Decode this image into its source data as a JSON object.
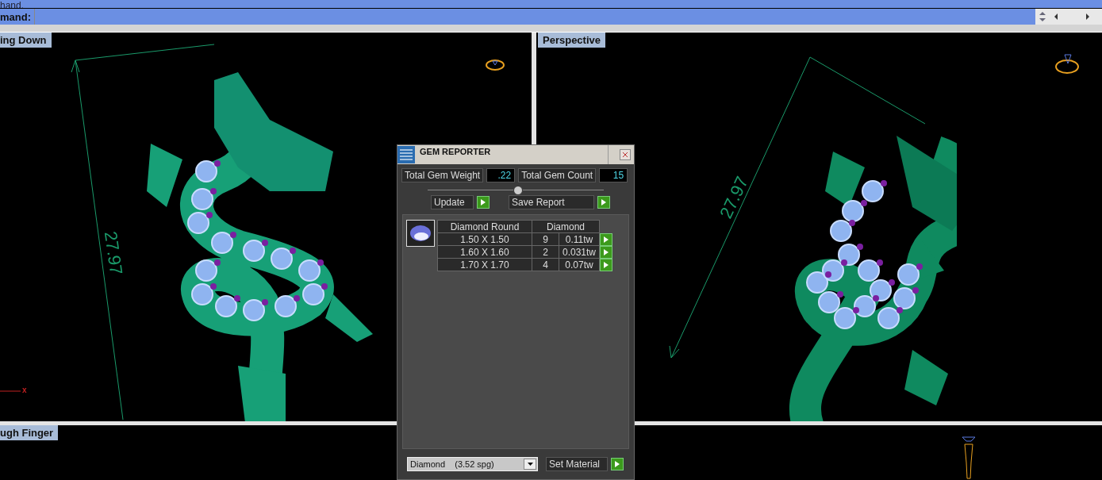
{
  "command_history": {
    "text": "hand."
  },
  "command_line": {
    "label": "mand:"
  },
  "viewports": [
    {
      "kind": "front",
      "title": "ing Down",
      "dimension": "27.97",
      "axis_label": "x"
    },
    {
      "kind": "perspective",
      "title": "Perspective",
      "dimension": "27.97"
    },
    {
      "kind": "empty",
      "title": "ugh Finger"
    },
    {
      "kind": "finger"
    }
  ],
  "gem_reporter": {
    "title": "GEM REPORTER",
    "total_weight": {
      "label": "Total Gem Weight",
      "value": ".22"
    },
    "total_count": {
      "label": "Total Gem Count",
      "value": "15"
    },
    "buttons": [
      "Update",
      "Save Report"
    ],
    "table": {
      "columns": [
        "Diamond Round",
        "Diamond"
      ],
      "rows": [
        {
          "size": "1.50 X 1.50",
          "count": "9",
          "weight": "0.11tw"
        },
        {
          "size": "1.60 X 1.60",
          "count": "2",
          "weight": "0.031tw"
        },
        {
          "size": "1.70 X 1.70",
          "count": "4",
          "weight": "0.07tw"
        }
      ]
    },
    "material": {
      "value": "Diamond    (3.52 spg)",
      "button": "Set Material"
    }
  }
}
